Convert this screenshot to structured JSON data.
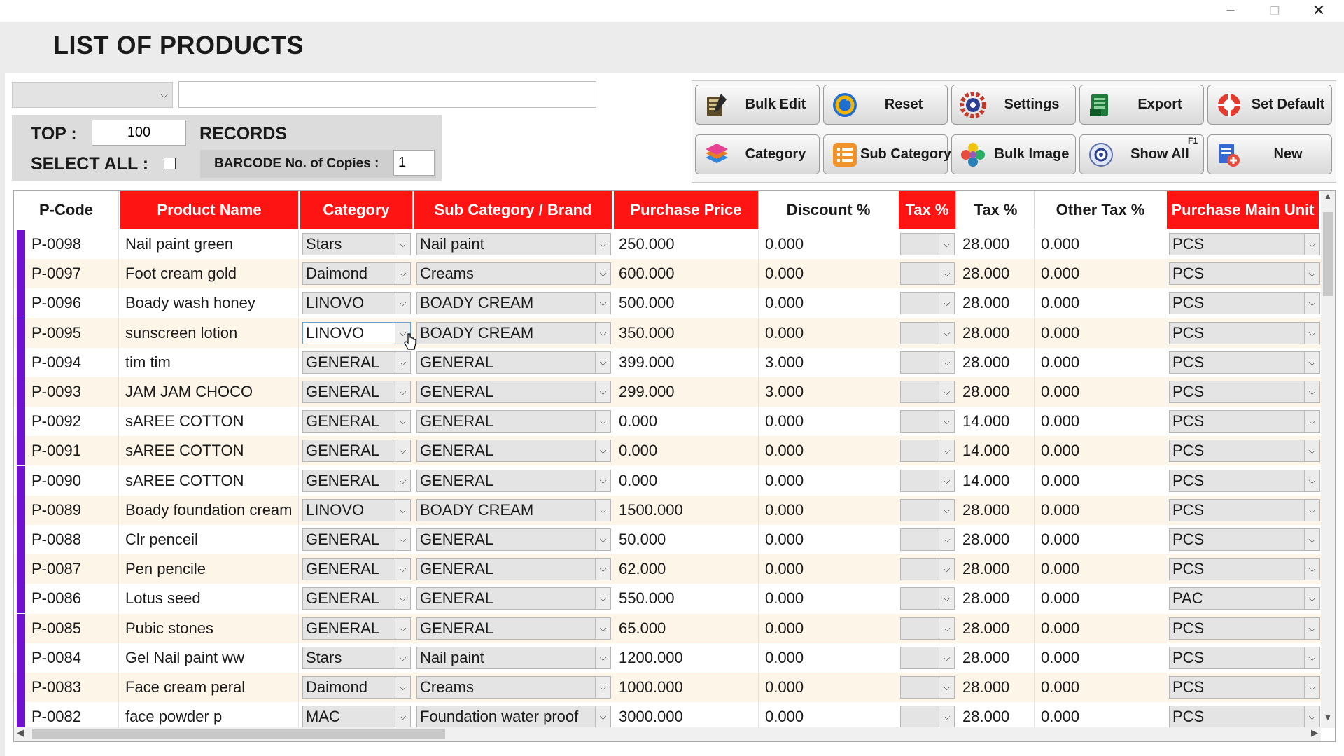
{
  "window": {
    "minimize": "─",
    "maximize": "❐",
    "close": "✕"
  },
  "page": {
    "title": "LIST OF PRODUCTS"
  },
  "filters": {
    "field_selector_value": "",
    "search_value": "",
    "top_label": "TOP :",
    "top_value": "100",
    "records_label": "RECORDS",
    "select_all_label": "SELECT ALL :",
    "select_all_checked": false,
    "barcode_label": "BARCODE No. of Copies :",
    "barcode_copies": "1"
  },
  "toolbar": {
    "bulk_edit": "Bulk Edit",
    "reset": "Reset",
    "settings": "Settings",
    "export": "Export",
    "set_default": "Set Default",
    "category": "Category",
    "sub_category": "Sub Category",
    "bulk_image": "Bulk Image",
    "show_all": "Show All",
    "show_all_shortcut": "F1",
    "new": "New"
  },
  "colors": {
    "header_required": "#ff1414",
    "row_marker": "#7011cf",
    "alt_row": "#fdf5e8"
  },
  "grid": {
    "columns": [
      "P-Code",
      "Product Name",
      "Category",
      "Sub Category / Brand",
      "Purchase Price",
      "Discount %",
      "Tax %",
      "Tax %",
      "Other Tax %",
      "Purchase Main Unit"
    ],
    "rows": [
      {
        "code": "P-0098",
        "name": "Nail paint green",
        "category": "Stars",
        "sub": "Nail paint",
        "price": "250.000",
        "discount": "0.000",
        "tax_sel": "",
        "tax": "28.000",
        "other_tax": "0.000",
        "unit": "PCS"
      },
      {
        "code": "P-0097",
        "name": "Foot cream gold",
        "category": "Daimond",
        "sub": "Creams",
        "price": "600.000",
        "discount": "0.000",
        "tax_sel": "",
        "tax": "28.000",
        "other_tax": "0.000",
        "unit": "PCS"
      },
      {
        "code": "P-0096",
        "name": "Boady wash honey",
        "category": "LINOVO",
        "sub": "BOADY CREAM",
        "price": "500.000",
        "discount": "0.000",
        "tax_sel": "",
        "tax": "28.000",
        "other_tax": "0.000",
        "unit": "PCS"
      },
      {
        "code": "P-0095",
        "name": "sunscreen lotion",
        "category": "LINOVO",
        "sub": "BOADY CREAM",
        "price": "350.000",
        "discount": "0.000",
        "tax_sel": "",
        "tax": "28.000",
        "other_tax": "0.000",
        "unit": "PCS"
      },
      {
        "code": "P-0094",
        "name": "tim tim",
        "category": "GENERAL",
        "sub": "GENERAL",
        "price": "399.000",
        "discount": "3.000",
        "tax_sel": "",
        "tax": "28.000",
        "other_tax": "0.000",
        "unit": "PCS"
      },
      {
        "code": "P-0093",
        "name": "JAM JAM CHOCO",
        "category": "GENERAL",
        "sub": "GENERAL",
        "price": "299.000",
        "discount": "3.000",
        "tax_sel": "",
        "tax": "28.000",
        "other_tax": "0.000",
        "unit": "PCS"
      },
      {
        "code": "P-0092",
        "name": "sAREE COTTON",
        "category": "GENERAL",
        "sub": "GENERAL",
        "price": "0.000",
        "discount": "0.000",
        "tax_sel": "",
        "tax": "14.000",
        "other_tax": "0.000",
        "unit": "PCS"
      },
      {
        "code": "P-0091",
        "name": "sAREE COTTON",
        "category": "GENERAL",
        "sub": "GENERAL",
        "price": "0.000",
        "discount": "0.000",
        "tax_sel": "",
        "tax": "14.000",
        "other_tax": "0.000",
        "unit": "PCS"
      },
      {
        "code": "P-0090",
        "name": "sAREE COTTON",
        "category": "GENERAL",
        "sub": "GENERAL",
        "price": "0.000",
        "discount": "0.000",
        "tax_sel": "",
        "tax": "14.000",
        "other_tax": "0.000",
        "unit": "PCS"
      },
      {
        "code": "P-0089",
        "name": "Boady foundation cream",
        "category": "LINOVO",
        "sub": "BOADY CREAM",
        "price": "1500.000",
        "discount": "0.000",
        "tax_sel": "",
        "tax": "28.000",
        "other_tax": "0.000",
        "unit": "PCS"
      },
      {
        "code": "P-0088",
        "name": "Clr penceil",
        "category": "GENERAL",
        "sub": "GENERAL",
        "price": "50.000",
        "discount": "0.000",
        "tax_sel": "",
        "tax": "28.000",
        "other_tax": "0.000",
        "unit": "PCS"
      },
      {
        "code": "P-0087",
        "name": "Pen pencile",
        "category": "GENERAL",
        "sub": "GENERAL",
        "price": "62.000",
        "discount": "0.000",
        "tax_sel": "",
        "tax": "28.000",
        "other_tax": "0.000",
        "unit": "PCS"
      },
      {
        "code": "P-0086",
        "name": "Lotus seed",
        "category": "GENERAL",
        "sub": "GENERAL",
        "price": "550.000",
        "discount": "0.000",
        "tax_sel": "",
        "tax": "28.000",
        "other_tax": "0.000",
        "unit": "PAC"
      },
      {
        "code": "P-0085",
        "name": "Pubic stones",
        "category": "GENERAL",
        "sub": "GENERAL",
        "price": "65.000",
        "discount": "0.000",
        "tax_sel": "",
        "tax": "28.000",
        "other_tax": "0.000",
        "unit": "PCS"
      },
      {
        "code": "P-0084",
        "name": "Gel Nail paint ww",
        "category": "Stars",
        "sub": "Nail paint",
        "price": "1200.000",
        "discount": "0.000",
        "tax_sel": "",
        "tax": "28.000",
        "other_tax": "0.000",
        "unit": "PCS"
      },
      {
        "code": "P-0083",
        "name": "Face cream peral",
        "category": "Daimond",
        "sub": "Creams",
        "price": "1000.000",
        "discount": "0.000",
        "tax_sel": "",
        "tax": "28.000",
        "other_tax": "0.000",
        "unit": "PCS"
      },
      {
        "code": "P-0082",
        "name": "face powder p",
        "category": "MAC",
        "sub": "Foundation water proof",
        "price": "3000.000",
        "discount": "0.000",
        "tax_sel": "",
        "tax": "28.000",
        "other_tax": "0.000",
        "unit": "PCS"
      }
    ]
  }
}
